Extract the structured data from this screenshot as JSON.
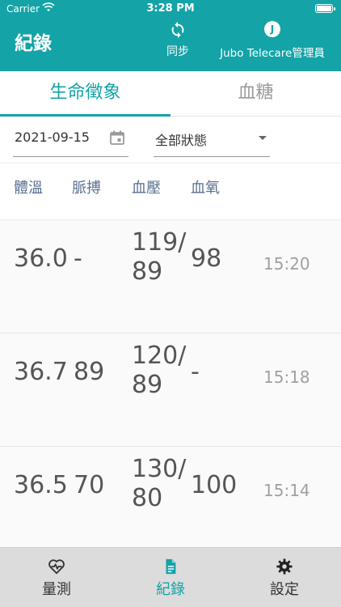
{
  "status_bar": {
    "carrier": "Carrier",
    "time": "3:28 PM"
  },
  "header": {
    "title": "紀錄",
    "sync_label": "同步",
    "avatar_initial": "J",
    "user_name": "Jubo Telecare管理員",
    "color": "#14a3a6"
  },
  "tabs": [
    {
      "label": "生命徵象",
      "active": true
    },
    {
      "label": "血糖",
      "active": false
    }
  ],
  "filters": {
    "date": "2021-09-15",
    "status": "全部狀態"
  },
  "columns": [
    "體溫",
    "脈搏",
    "血壓",
    "血氧"
  ],
  "records": [
    {
      "temp": "36.0",
      "pulse": "-",
      "bp_sys": "119/",
      "bp_dia": "89",
      "spo2": "98",
      "time": "15:20"
    },
    {
      "temp": "36.7",
      "pulse": "89",
      "bp_sys": "120/",
      "bp_dia": "89",
      "spo2": "-",
      "time": "15:18"
    },
    {
      "temp": "36.5",
      "pulse": "70",
      "bp_sys": "130/",
      "bp_dia": "80",
      "spo2": "100",
      "time": "15:14"
    }
  ],
  "tabbar": [
    {
      "label": "量測",
      "icon": "heart-pulse-icon",
      "active": false
    },
    {
      "label": "紀錄",
      "icon": "document-icon",
      "active": true
    },
    {
      "label": "設定",
      "icon": "gear-icon",
      "active": false
    }
  ]
}
